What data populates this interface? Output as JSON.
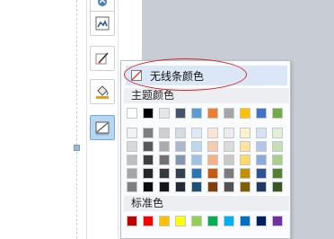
{
  "color_menu": {
    "no_line_label": "无线条颜色",
    "theme_colors_label": "主题颜色",
    "standard_colors_label": "标准色",
    "theme_row": [
      "#ffffff",
      "#000000",
      "#e7e6e6",
      "#44546a",
      "#5b9bd5",
      "#ed7d31",
      "#a5a5a5",
      "#ffc000",
      "#4472c4",
      "#70ad47"
    ],
    "theme_tints": [
      [
        "#f2f2f2",
        "#7f7f7f",
        "#d0cece",
        "#d6dce4",
        "#deebf6",
        "#fbe5d5",
        "#ededed",
        "#fff2cc",
        "#d9e2f3",
        "#e2efd9"
      ],
      [
        "#d8d8d8",
        "#595959",
        "#aeaaaa",
        "#adb9ca",
        "#bdd7ee",
        "#f7cbac",
        "#dbdbdb",
        "#fee599",
        "#b4c6e7",
        "#c5e0b3"
      ],
      [
        "#bfbfbf",
        "#3f3f3f",
        "#757070",
        "#8496b0",
        "#9cc3e5",
        "#f4b183",
        "#c9c9c9",
        "#ffd965",
        "#8eaadb",
        "#a8d08d"
      ],
      [
        "#a5a5a5",
        "#262626",
        "#3a3838",
        "#323f4f",
        "#2e75b5",
        "#c55a11",
        "#7b7b7b",
        "#bf9000",
        "#2f5496",
        "#538135"
      ],
      [
        "#7f7f7f",
        "#0c0c0c",
        "#171616",
        "#222a35",
        "#1e4e79",
        "#833c0b",
        "#525252",
        "#7f6000",
        "#1f3864",
        "#375623"
      ]
    ],
    "standard_row": [
      "#c00000",
      "#ff0000",
      "#ffc000",
      "#ffff00",
      "#92d050",
      "#00b050",
      "#00b0f0",
      "#0070c0",
      "#002060",
      "#7030a0"
    ]
  },
  "sidebar": {
    "buttons": [
      {
        "icon": "shape-icon",
        "active": false
      },
      {
        "icon": "picture-icon",
        "active": false
      },
      {
        "icon": "edit-shape-icon",
        "active": false
      },
      {
        "icon": "fill-bucket-icon",
        "active": false
      },
      {
        "icon": "line-color-icon",
        "active": true
      }
    ]
  }
}
